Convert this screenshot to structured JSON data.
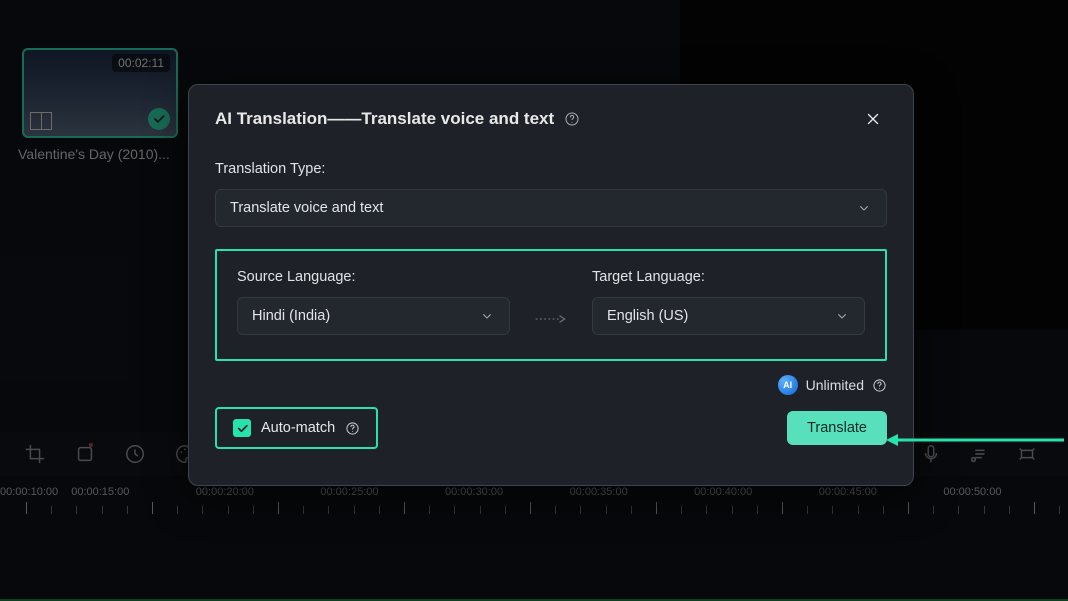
{
  "clip": {
    "duration": "00:02:11",
    "title": "Valentine's Day (2010)..."
  },
  "modal": {
    "title": "AI Translation——Translate voice and text",
    "translation_type_label": "Translation Type:",
    "translation_type_value": "Translate voice and text",
    "source_language_label": "Source Language:",
    "source_language_value": "Hindi (India)",
    "target_language_label": "Target Language:",
    "target_language_value": "English (US)",
    "unlimited_label": "Unlimited",
    "auto_match_label": "Auto-match",
    "translate_button": "Translate"
  },
  "timeline": {
    "labels": [
      "00:00:10:00",
      "00:00:15:00",
      "00:00:20:00",
      "00:00:25:00",
      "00:00:30:00",
      "00:00:35:00",
      "00:00:40:00",
      "00:00:45:00",
      "00:00:50:00"
    ]
  },
  "icons": {
    "ai_badge": "AI"
  }
}
